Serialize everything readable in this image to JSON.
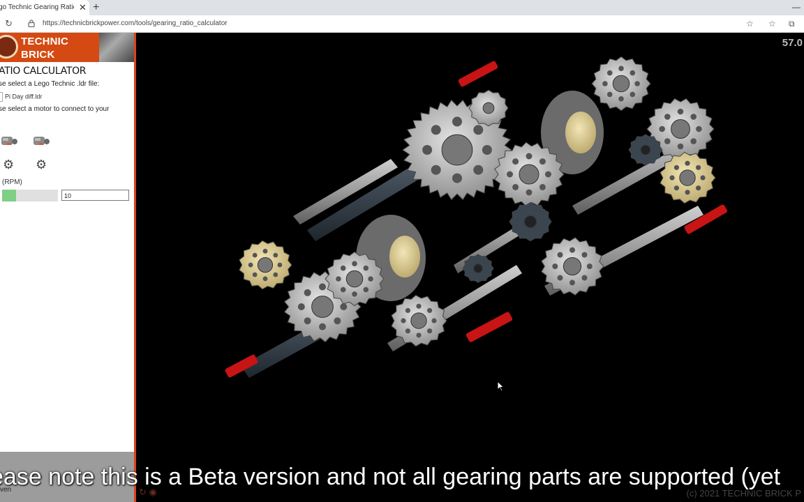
{
  "browser": {
    "tab_title": "go Technic Gearing Ratio Calc",
    "new_tab_icon": "plus-icon",
    "url": "https://technicbrickpower.com/tools/gearing_ratio_calculator"
  },
  "panel": {
    "brand": "TECHNIC BRICK POWER",
    "title": "ATIO CALCULATOR",
    "select_file_label": "se select a Lego Technic .ldr file:",
    "file_name": "Pi Day diff.ldr",
    "select_motor_label": "se select a motor to connect to your",
    "rpm_label": "(RPM)",
    "rpm_value": "10",
    "rpm_slider_fraction": 0.25,
    "footer_text": "ven"
  },
  "viewport": {
    "fps": "57.0",
    "copyright": "(c) 2021 TECHNIC BRICK P"
  },
  "subtitle": "ease note this is a Beta version and not all gearing parts are supported (yet",
  "colors": {
    "brand_orange": "#d44a12",
    "gear_gray": "#9a9a9a",
    "gear_tan": "#d9c98d",
    "axle_red": "#d01818",
    "axle_dark": "#2f3a44"
  }
}
